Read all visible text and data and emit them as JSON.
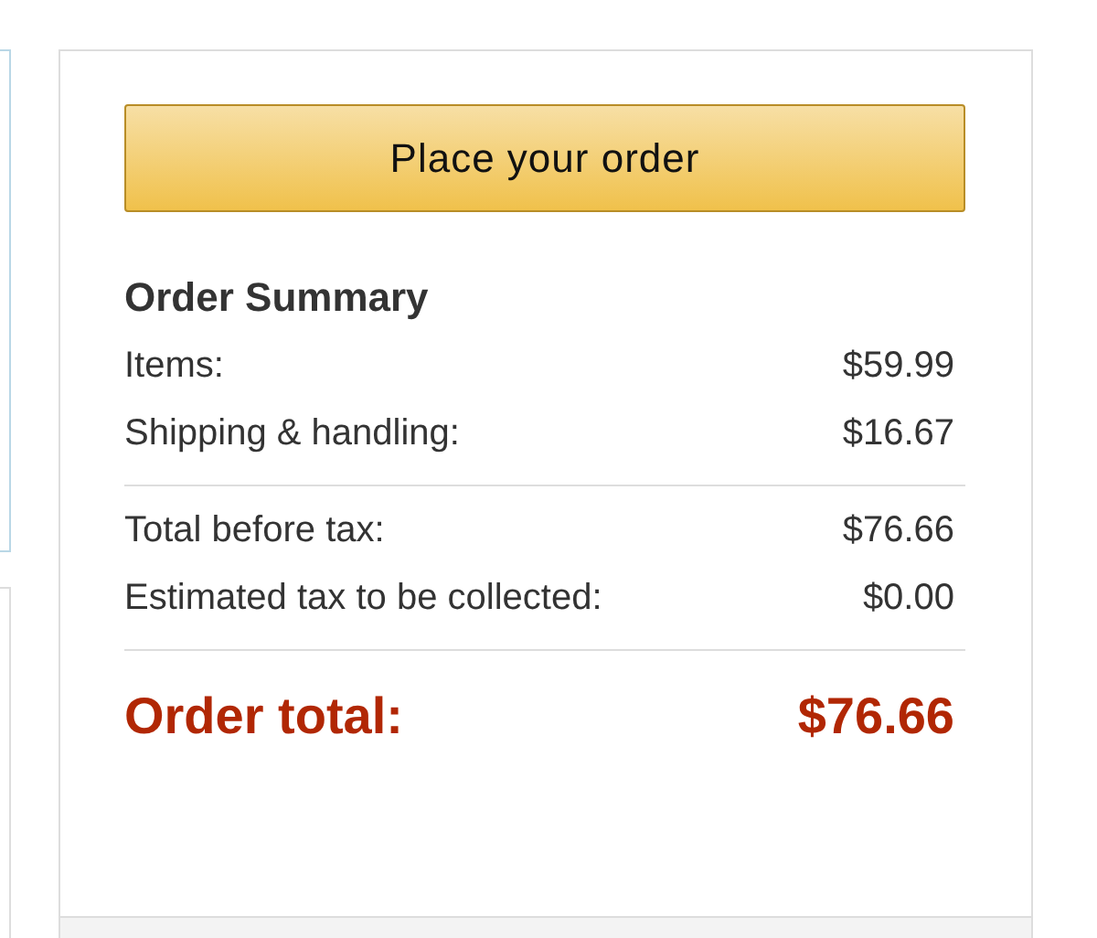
{
  "place_order_button": {
    "label": "Place your order"
  },
  "order_summary": {
    "title": "Order Summary",
    "groups": [
      [
        {
          "label": "Items:",
          "amount": "$59.99"
        },
        {
          "label": "Shipping & handling:",
          "amount": "$16.67"
        }
      ],
      [
        {
          "label": "Total before tax:",
          "amount": "$76.66"
        },
        {
          "label": "Estimated tax to be collected:",
          "amount": "$0.00"
        }
      ]
    ],
    "total": {
      "label": "Order total:",
      "amount": "$76.66"
    }
  }
}
